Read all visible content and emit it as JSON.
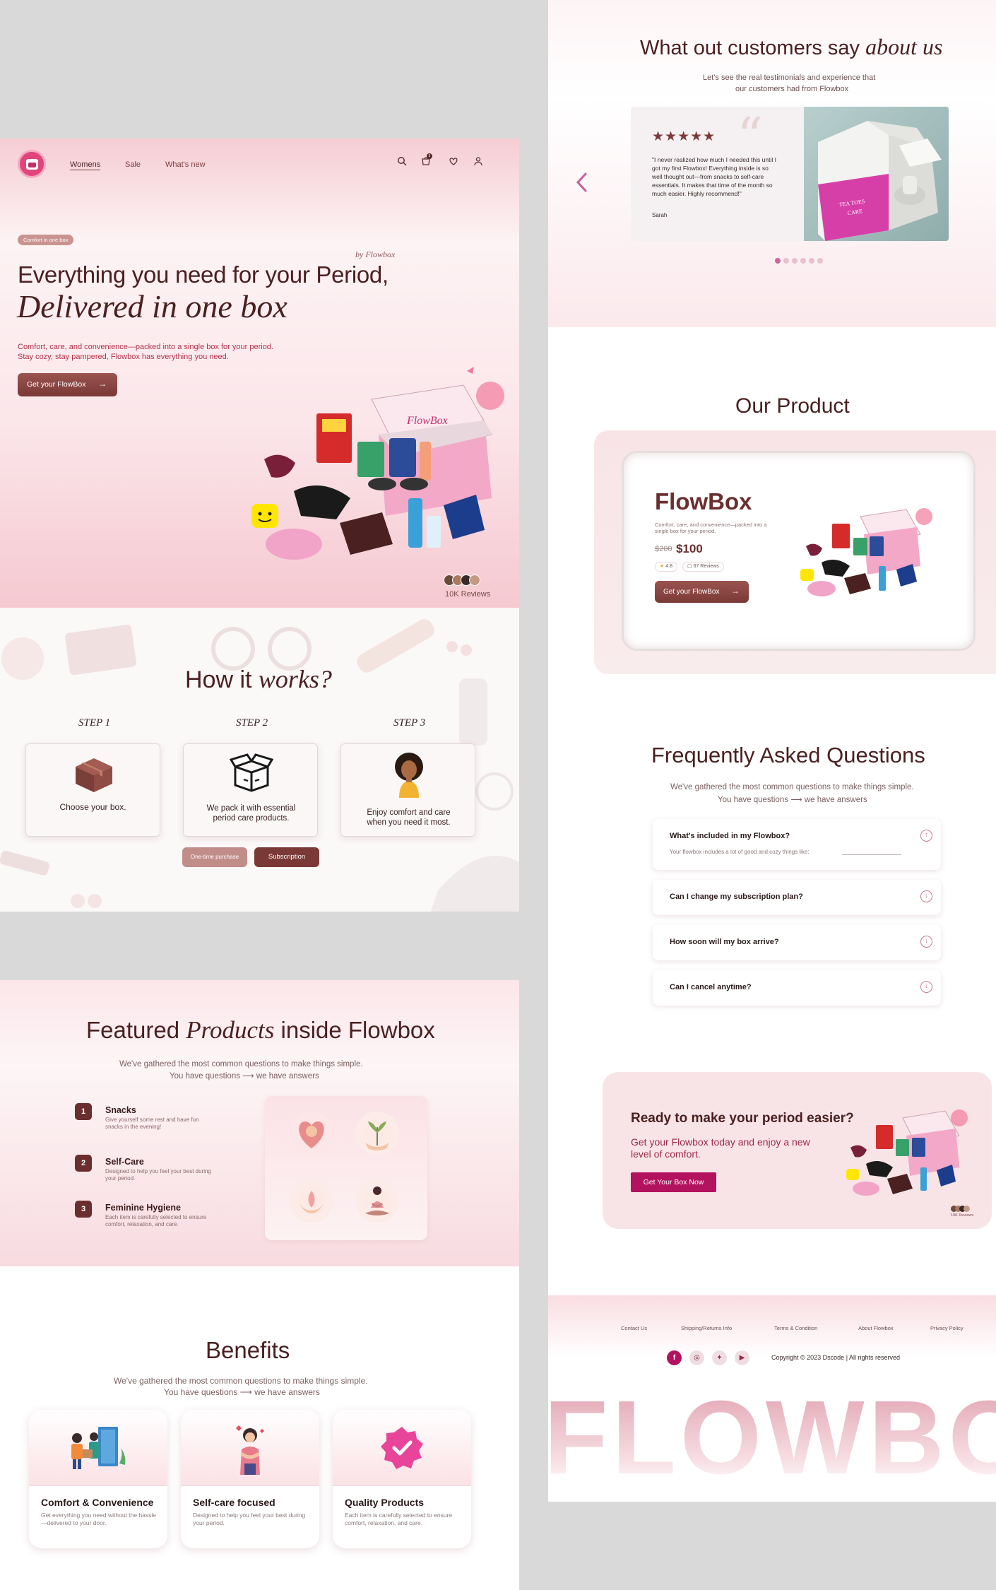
{
  "nav": {
    "links": [
      "Womens",
      "Sale",
      "What's new"
    ],
    "cart_count": "2"
  },
  "hero": {
    "badge": "Comfort in one box",
    "by_line": "by Flowbox",
    "title_line1": "Everything you need for your Period,",
    "title_line2": "Delivered in one box",
    "desc_line1": "Comfort, care, and convenience—packed into a single box for your period.",
    "desc_line2": "Stay cozy, stay pampered, Flowbox has everything you need.",
    "cta": "Get your FlowBox",
    "reviews": "10K Reviews",
    "box_brand": "FlowBox"
  },
  "how": {
    "title_regular": "How it ",
    "title_italic": "works?",
    "steps": [
      {
        "label": "STEP 1",
        "text": "Choose your box."
      },
      {
        "label": "STEP 2",
        "text": "We pack it with essential period care products."
      },
      {
        "label": "STEP 3",
        "text": "Enjoy comfort and care when you need it most."
      }
    ],
    "buttons": [
      "One-time purchase",
      "Subscription"
    ]
  },
  "featured": {
    "title_a": "Featured ",
    "title_italic": "Products",
    "title_b": " inside Flowbox",
    "sub_line1": "We've gathered the most common questions to make things simple.",
    "sub_line2a": "You have questions",
    "sub_line2b": "we have answers",
    "items": [
      {
        "num": "1",
        "title": "Snacks",
        "desc": "Give yourself some rest and have fun snacks in the evening!"
      },
      {
        "num": "2",
        "title": "Self-Care",
        "desc": "Designed to help you feel your best during your period."
      },
      {
        "num": "3",
        "title": "Feminine Hygiene",
        "desc": "Each item is carefully selected to ensure comfort, relaxation, and care."
      }
    ]
  },
  "benefits": {
    "title": "Benefits",
    "sub_line1": "We've gathered the most common questions to make things simple.",
    "sub_line2a": "You have questions",
    "sub_line2b": "we have answers",
    "cards": [
      {
        "title": "Comfort & Convenience",
        "desc": "Get everything you need without the hassle—delivered to your door."
      },
      {
        "title": "Self-care focused",
        "desc": "Designed to help you feel your best during your period."
      },
      {
        "title": "Quality Products",
        "desc": "Each item is carefully selected to ensure comfort, relaxation, and care."
      }
    ]
  },
  "testimonials": {
    "title_regular": "What out customers say ",
    "title_italic": "about us",
    "sub_line1": "Let's see the real testimonials and experience that",
    "sub_line2": "our customers had from Flowbox",
    "stars": "★★★★★",
    "quote": "\"I never realized how much I needed this until I got my first Flowbox! Everything inside is so well thought out—from snacks to self-care essentials. It makes that time of the month so much easier. Highly recommend!\"",
    "author": "Sarah",
    "box_text": "FEA TOES\nCARE"
  },
  "product": {
    "section_title": "Our Product",
    "name": "FlowBox",
    "desc": "Comfort, care, and convenience—packed into a single box for your period.",
    "old_price": "$200",
    "price": "$100",
    "rating": "4.8",
    "reviews": "67 Reviews",
    "cta": "Get your FlowBox"
  },
  "faq": {
    "title": "Frequently Asked Questions",
    "sub_line1": "We've gathered the most common questions to make things simple.",
    "sub_line2a": "You have questions",
    "sub_line2b": "we have answers",
    "items": [
      {
        "q": "What's included in my Flowbox?",
        "a": "Your flowbox includes a lot of good and cozy things like:"
      },
      {
        "q": "Can I change my subscription plan?"
      },
      {
        "q": "How soon will my box arrive?"
      },
      {
        "q": "Can I cancel anytime?"
      }
    ]
  },
  "cta_banner": {
    "title": "Ready to make your period easier?",
    "desc": "Get your Flowbox today and enjoy a new level of comfort.",
    "button": "Get Your Box Now",
    "reviews": "10K Reviews"
  },
  "footer": {
    "links": [
      "Contact Us",
      "Shipping/Returns Info",
      "Terms & Condition",
      "About Flowbox",
      "Privacy Policy"
    ],
    "copyright": "Copyright © 2023 Dscode | All rights reserved",
    "big_word": "FLOWBOX"
  },
  "colors": {
    "brand_brown": "#7a3936",
    "brand_pink": "#e0457b",
    "cta_magenta": "#b3125e"
  }
}
